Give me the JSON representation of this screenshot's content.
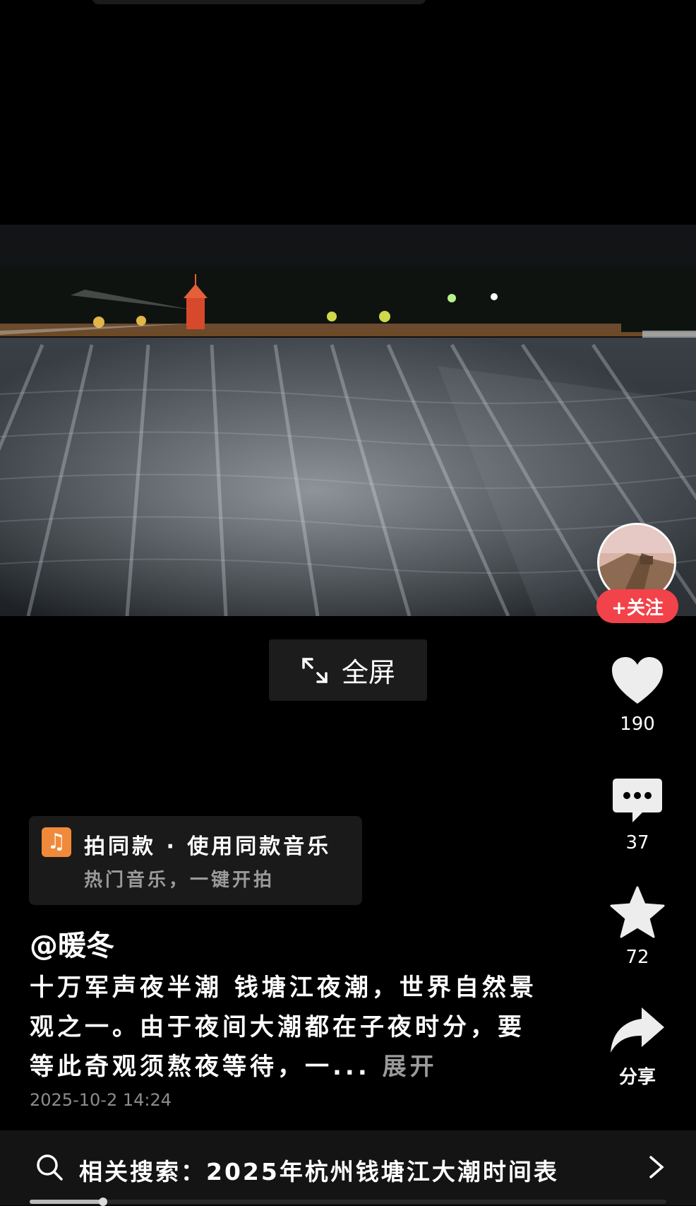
{
  "video": {
    "fullscreen_label": "全屏",
    "progress": 0.115
  },
  "creator": {
    "follow_label": "+关注"
  },
  "actions": {
    "likes": "190",
    "comments": "37",
    "favorites": "72",
    "share_label": "分享"
  },
  "music": {
    "title": "拍同款 · 使用同款音乐",
    "subtitle": "热门音乐，一键开拍",
    "icon": "music-note-icon"
  },
  "post": {
    "author": "@暖冬",
    "description": "十万军声夜半潮 钱塘江夜潮，世界自然景观之一。由于夜间大潮都在子夜时分，要等此奇观须熬夜等待，一...",
    "expand_label": "展开",
    "timestamp": "2025-10-2  14:24"
  },
  "related_search": {
    "text": "相关搜索：2025年杭州钱塘江大潮时间表"
  },
  "colors": {
    "accent_red": "#f2424a",
    "music_orange": "#f08a3a"
  }
}
